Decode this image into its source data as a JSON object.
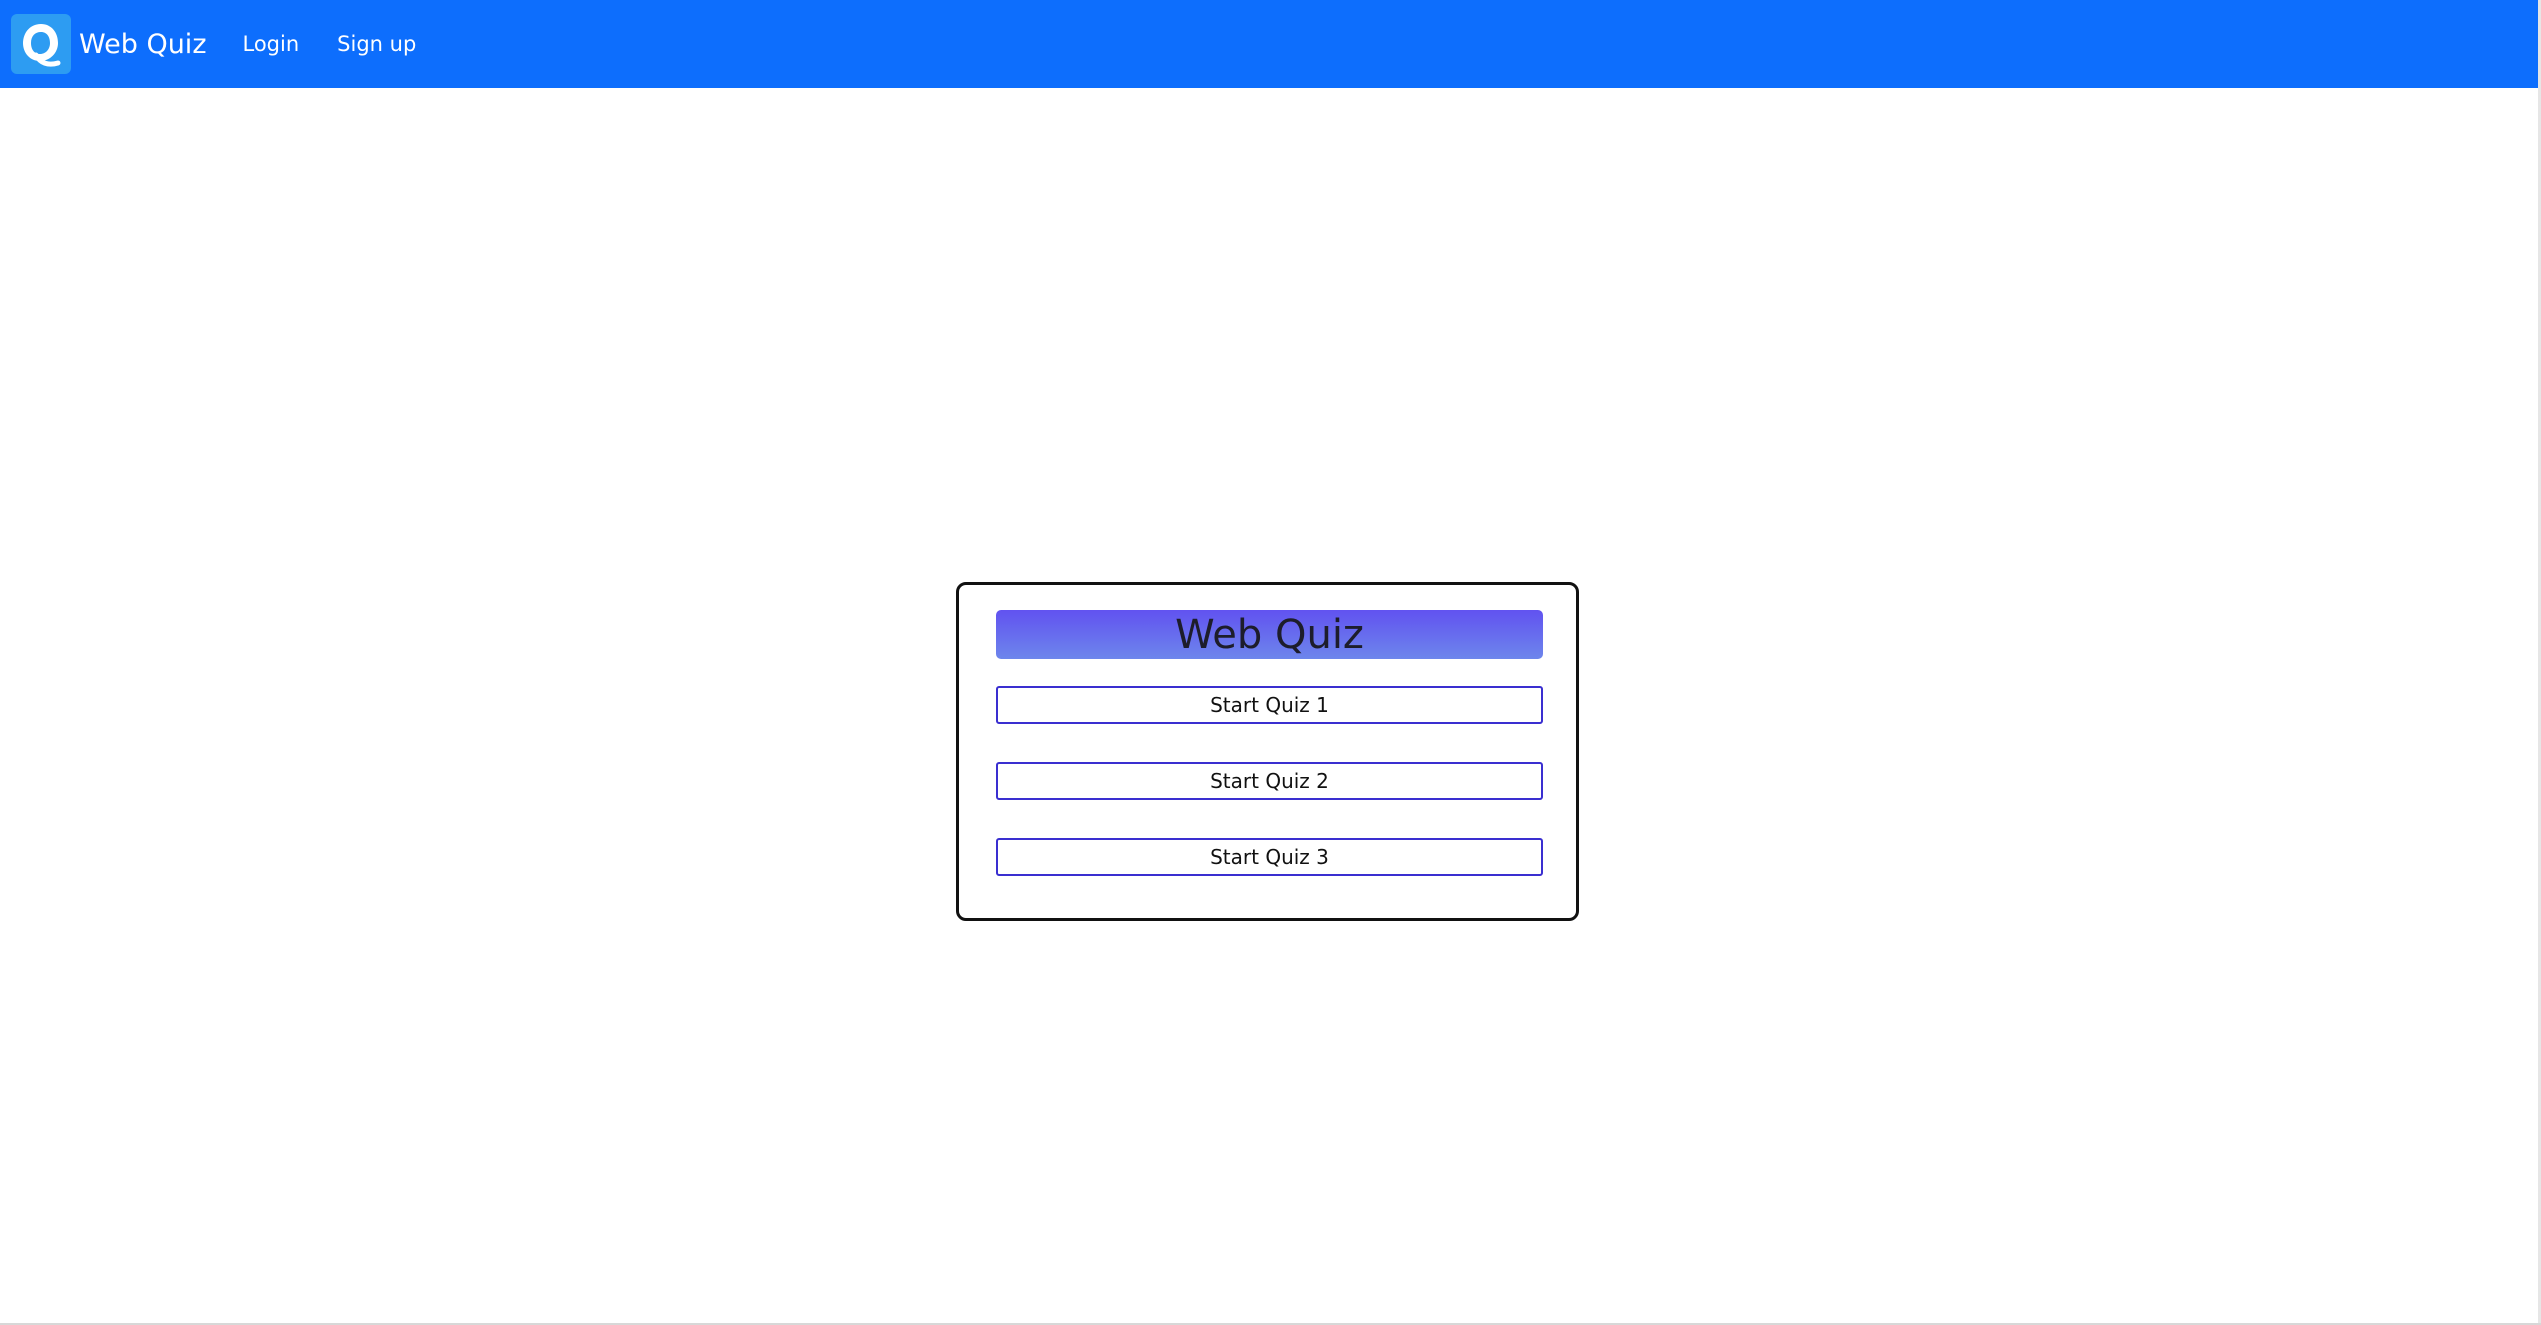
{
  "navbar": {
    "brand_label": "Web Quiz",
    "logo_icon": "quiz-q-logo-icon",
    "links": [
      {
        "label": "Login"
      },
      {
        "label": "Sign up"
      }
    ],
    "background_color": "#0d6efd"
  },
  "card": {
    "title": "Web Quiz",
    "buttons": [
      {
        "label": "Start Quiz 1"
      },
      {
        "label": "Start Quiz 2"
      },
      {
        "label": "Start Quiz 3"
      }
    ],
    "title_gradient": [
      "#6152f0",
      "#6d86ec"
    ],
    "button_border_color": "#3a2fd0"
  }
}
